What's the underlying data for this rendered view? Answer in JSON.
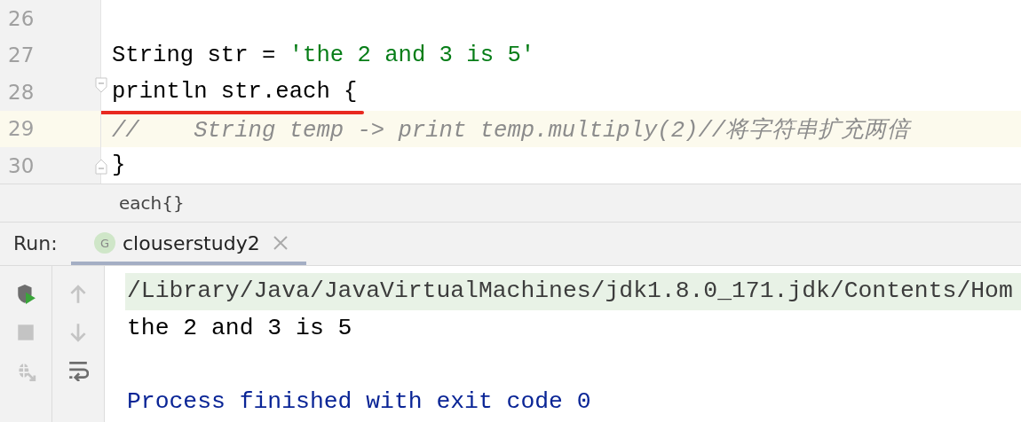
{
  "editor": {
    "lines": [
      {
        "number": "26",
        "current": false,
        "underlined": false,
        "fold_open": false,
        "fold_close": false
      },
      {
        "number": "27",
        "current": false,
        "underlined": false,
        "fold_open": false,
        "fold_close": false,
        "tokens": [
          {
            "text": "String str = ",
            "kind": "plain"
          },
          {
            "text": "'the 2 and 3 is 5'",
            "kind": "string"
          }
        ]
      },
      {
        "number": "28",
        "current": false,
        "underlined": true,
        "fold_open": true,
        "fold_close": false,
        "tokens": [
          {
            "text": "println str.each {",
            "kind": "plain"
          }
        ]
      },
      {
        "number": "29",
        "current": true,
        "underlined": false,
        "fold_open": false,
        "fold_close": false,
        "tokens": [
          {
            "text": "//    String temp -> print temp.multiply(2)//将字符串扩充两倍",
            "kind": "comment"
          }
        ]
      },
      {
        "number": "30",
        "current": false,
        "underlined": false,
        "fold_open": false,
        "fold_close": true,
        "tokens": [
          {
            "text": "}",
            "kind": "plain"
          }
        ]
      }
    ]
  },
  "breadcrumb": "each{}",
  "run_panel": {
    "label": "Run:",
    "tabs": [
      {
        "icon_letter": "G",
        "title": "clouserstudy2",
        "selected": true,
        "closable": true
      }
    ],
    "tools_left": [
      {
        "kind": "rerun",
        "disabled": false
      },
      {
        "kind": "stop",
        "disabled": true
      },
      {
        "kind": "debug",
        "disabled": true
      }
    ],
    "tools_right": [
      {
        "kind": "up",
        "disabled": true
      },
      {
        "kind": "down",
        "disabled": true
      },
      {
        "kind": "wrap",
        "disabled": false
      }
    ],
    "console": [
      {
        "kind": "command",
        "text": "/Library/Java/JavaVirtualMachines/jdk1.8.0_171.jdk/Contents/Hom"
      },
      {
        "kind": "output",
        "text": "the 2 and 3 is 5"
      },
      {
        "kind": "system",
        "text": "Process finished with exit code 0"
      }
    ]
  }
}
